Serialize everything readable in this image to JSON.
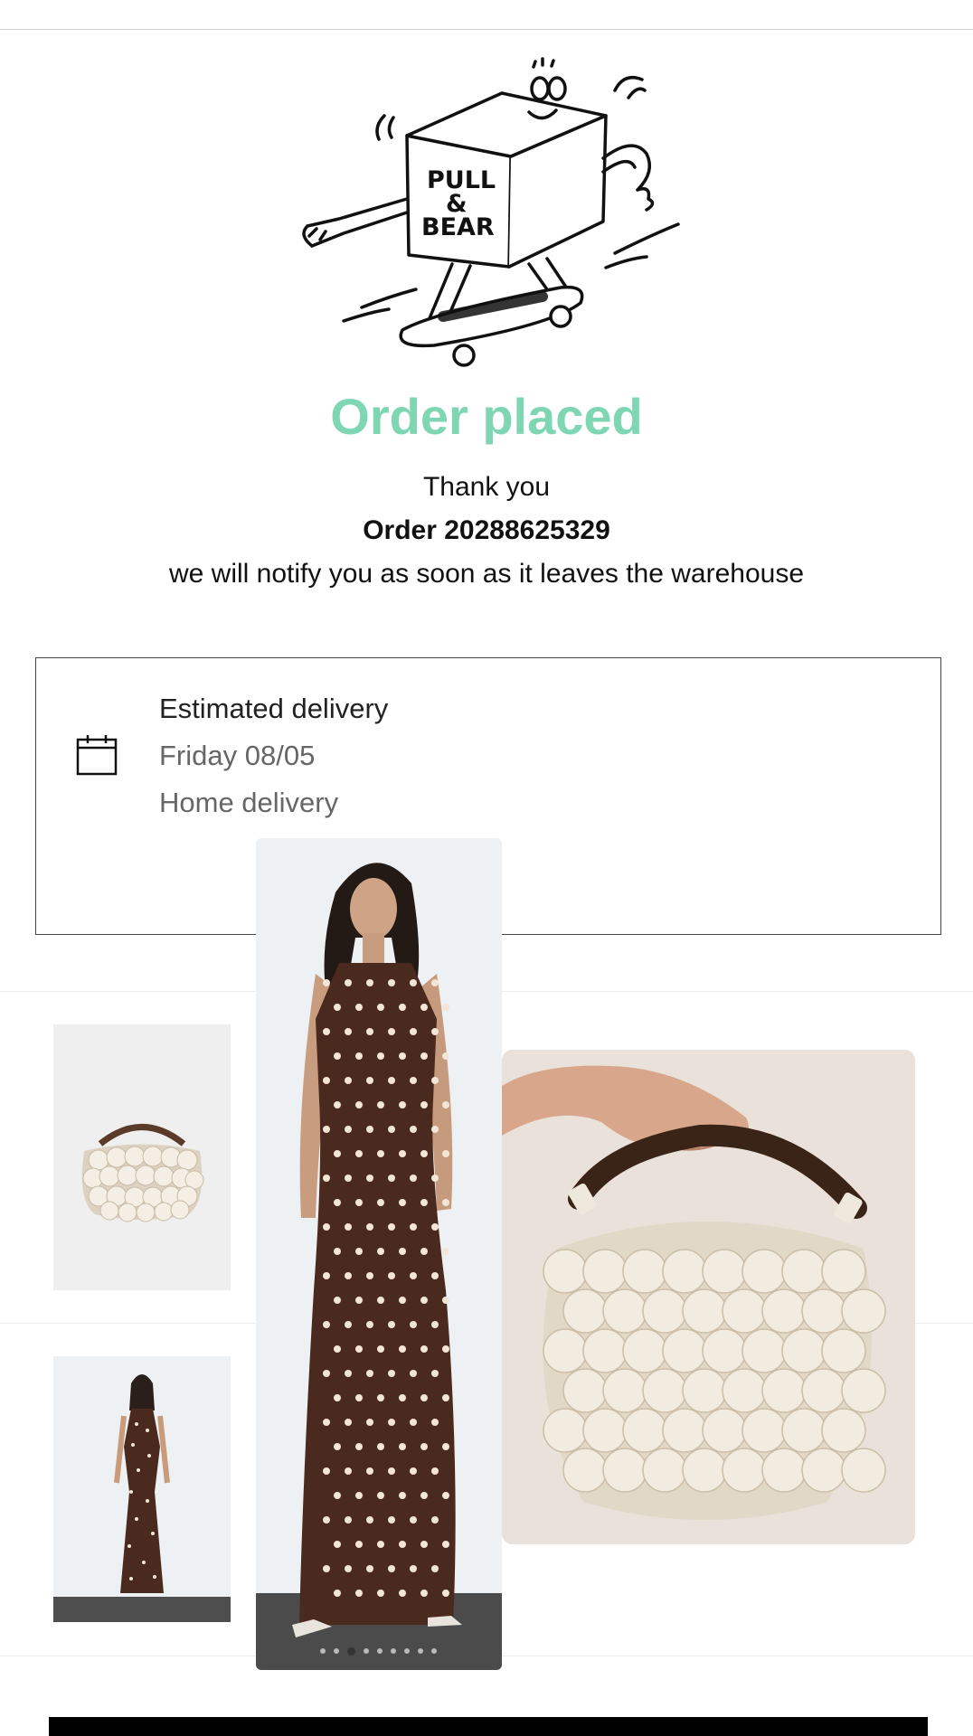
{
  "confirmation": {
    "logo_lines": [
      "PULL",
      "&",
      "BEAR"
    ],
    "title": "Order placed",
    "thank_you": "Thank you",
    "order_number": "Order 20288625329",
    "notify": "we will notify you as soon as it leaves the warehouse"
  },
  "delivery": {
    "icon": "calendar-icon",
    "title": "Estimated delivery",
    "date": "Friday 08/05",
    "method": "Home delivery"
  },
  "order_items": [
    {
      "name": "shell-handbag",
      "icon": "handbag-image"
    },
    {
      "name": "polka-dot-dress",
      "icon": "dress-image"
    }
  ],
  "gallery": {
    "current_index": 2,
    "total": 9
  },
  "colors": {
    "accent": "#7fd6b2",
    "dress": "#4a2a1e",
    "dots": "#f3e6d6",
    "shell": "#f2ebe0",
    "handle": "#3a2317"
  }
}
